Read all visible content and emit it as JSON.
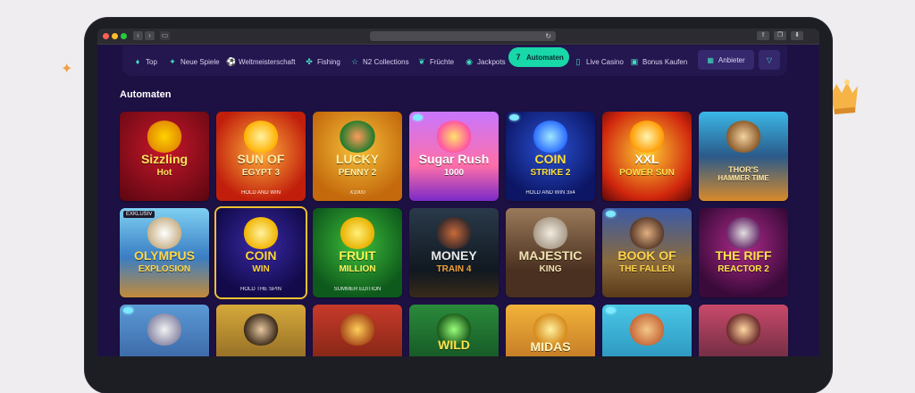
{
  "page": {
    "section_title": "Automaten"
  },
  "categories": [
    {
      "label": "Top",
      "icon": "flame-icon",
      "glyph": "♦"
    },
    {
      "label": "Neue Spiele",
      "icon": "sparkle-icon",
      "glyph": "✦"
    },
    {
      "label": "Weltmeisterschaft",
      "icon": "football-icon",
      "glyph": "⚽"
    },
    {
      "label": "Fishing",
      "icon": "fish-icon",
      "glyph": "✤"
    },
    {
      "label": "N2 Collections",
      "icon": "star-icon",
      "glyph": "☆"
    },
    {
      "label": "Früchte",
      "icon": "cherry-icon",
      "glyph": "❦"
    },
    {
      "label": "Jackpots",
      "icon": "coin-icon",
      "glyph": "◉"
    },
    {
      "label": "Automaten",
      "icon": "slot-icon",
      "glyph": "7"
    },
    {
      "label": "Live Casino",
      "icon": "phone-icon",
      "glyph": "▯"
    },
    {
      "label": "Bonus Kaufen",
      "icon": "gift-icon",
      "glyph": "▣"
    }
  ],
  "provider_button": {
    "label": "Anbieter",
    "icon": "grid-icon"
  },
  "filter_button": {
    "icon": "filter-icon"
  },
  "games": [
    {
      "line1": "Sizzling",
      "line2": "Hot",
      "sub": "",
      "badge": ""
    },
    {
      "line1": "SUN OF",
      "line2": "EGYPT 3",
      "sub": "HOLD AND WIN",
      "badge": ""
    },
    {
      "line1": "LUCKY",
      "line2": "PENNY 2",
      "sub": "X1000",
      "badge": ""
    },
    {
      "line1": "Sugar Rush",
      "line2": "1000",
      "sub": "",
      "badge": ""
    },
    {
      "line1": "COIN",
      "line2": "STRIKE 2",
      "sub": "HOLD AND WIN 3x4",
      "badge": ""
    },
    {
      "line1": "XXL",
      "line2": "POWER SUN",
      "sub": "",
      "badge": ""
    },
    {
      "line1": "THOR'S",
      "line2": "HAMMER TIME",
      "sub": "",
      "badge": ""
    },
    {
      "line1": "OLYMPUS",
      "line2": "EXPLOSION",
      "sub": "",
      "badge": "EXKLUSIV"
    },
    {
      "line1": "COIN",
      "line2": "WIN",
      "sub": "HOLD THE SPIN",
      "badge": ""
    },
    {
      "line1": "FRUIT",
      "line2": "MILLION",
      "sub": "SUMMER EDITION",
      "badge": ""
    },
    {
      "line1": "MONEY",
      "line2": "TRAIN 4",
      "sub": "",
      "badge": ""
    },
    {
      "line1": "MAJESTIC",
      "line2": "KING",
      "sub": "",
      "badge": ""
    },
    {
      "line1": "BOOK OF",
      "line2": "THE FALLEN",
      "sub": "",
      "badge": ""
    },
    {
      "line1": "THE RIFF",
      "line2": "REACTOR 2",
      "sub": "",
      "badge": ""
    },
    {
      "line1": "",
      "line2": "",
      "sub": "",
      "badge": ""
    },
    {
      "line1": "",
      "line2": "",
      "sub": "",
      "badge": ""
    },
    {
      "line1": "",
      "line2": "",
      "sub": "",
      "badge": ""
    },
    {
      "line1": "WILD",
      "line2": "",
      "sub": "",
      "badge": ""
    },
    {
      "line1": "MIDAS",
      "line2": "",
      "sub": "",
      "badge": ""
    },
    {
      "line1": "",
      "line2": "",
      "sub": "",
      "badge": ""
    },
    {
      "line1": "",
      "line2": "",
      "sub": "",
      "badge": ""
    }
  ],
  "colors": {
    "background": "#1d1143",
    "accent": "#18d7a8",
    "category_bar": "#24164f"
  }
}
